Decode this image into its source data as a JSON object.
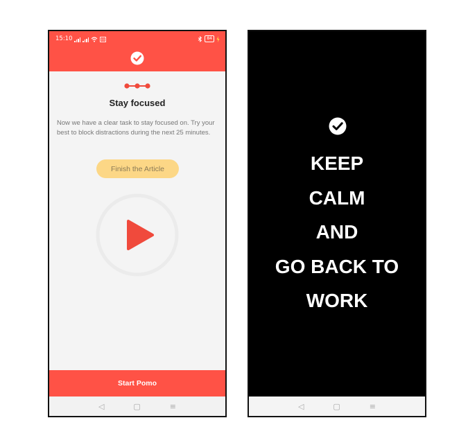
{
  "phone1": {
    "status": {
      "time": "15:10",
      "battery": "84"
    },
    "header": {
      "icon": "check-circle-icon",
      "color": "#ff5246"
    },
    "steps": {
      "count": 3,
      "icon": "progress-dots-icon"
    },
    "title": "Stay focused",
    "description": "Now we have a clear task to stay focused on. Try your best to block distractions during the next 25 minutes.",
    "task": {
      "label": "Finish the Article",
      "color": "#fcd786"
    },
    "play": {
      "icon": "play-icon",
      "color": "#f04a3c"
    },
    "primary_button": {
      "label": "Start Pomo",
      "color": "#ff5246"
    },
    "nav": [
      {
        "name": "back",
        "glyph": "◁"
      },
      {
        "name": "home",
        "glyph": "▢"
      },
      {
        "name": "recents",
        "glyph": "≡"
      }
    ]
  },
  "phone2": {
    "icon": "check-circle-icon",
    "lines": [
      "KEEP",
      "CALM",
      "AND",
      "GO BACK TO",
      "WORK"
    ],
    "nav": [
      {
        "name": "back",
        "glyph": "◁"
      },
      {
        "name": "home",
        "glyph": "▢"
      },
      {
        "name": "recents",
        "glyph": "≡"
      }
    ]
  }
}
